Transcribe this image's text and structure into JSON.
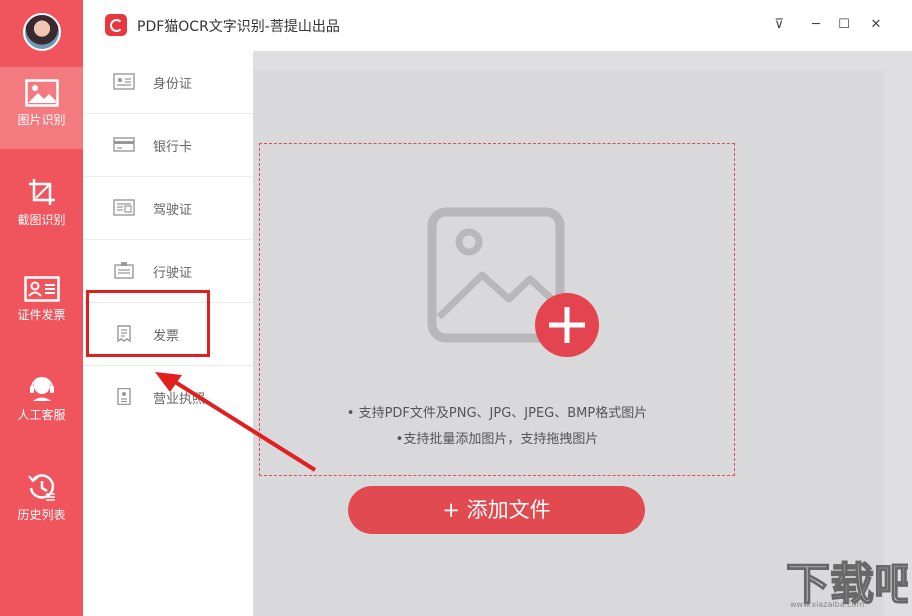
{
  "window": {
    "title": "PDF猫OCR文字识别-菩提山出品",
    "controls": [
      "⊽",
      "─",
      "☐",
      "✕"
    ]
  },
  "rail": {
    "items": [
      {
        "label": "图片识别",
        "icon": "image-icon",
        "active": true
      },
      {
        "label": "截图识别",
        "icon": "crop-icon",
        "active": false
      },
      {
        "label": "证件发票",
        "icon": "id-card-icon",
        "active": false
      },
      {
        "label": "人工客服",
        "icon": "headset-icon",
        "active": false
      },
      {
        "label": "历史列表",
        "icon": "history-icon",
        "active": false
      }
    ]
  },
  "submenu": {
    "items": [
      {
        "label": "身份证",
        "icon": "id-card-icon"
      },
      {
        "label": "银行卡",
        "icon": "bank-card-icon"
      },
      {
        "label": "驾驶证",
        "icon": "driver-license-icon"
      },
      {
        "label": "行驶证",
        "icon": "vehicle-license-icon"
      },
      {
        "label": "发票",
        "icon": "invoice-icon"
      },
      {
        "label": "营业执照",
        "icon": "business-license-icon"
      }
    ]
  },
  "dropzone": {
    "hint1": "• 支持PDF文件及PNG、JPG、JPEG、BMP格式图片",
    "hint2": "•支持批量添加图片，支持拖拽图片"
  },
  "add_button": {
    "label": "+  添加文件"
  },
  "watermark": {
    "text": "下载吧",
    "url": "www.xiazaiba.com"
  },
  "colors": {
    "rail": "#f0545c",
    "accent": "#e24a52",
    "annotation": "#e01f1f"
  }
}
